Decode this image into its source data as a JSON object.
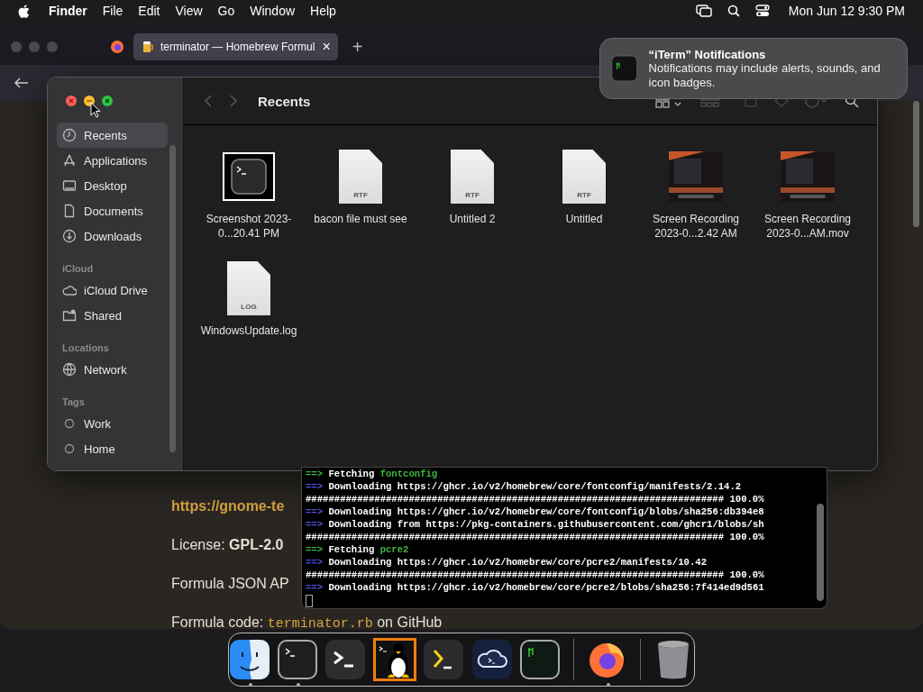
{
  "menu_bar": {
    "app": "Finder",
    "menus": [
      "File",
      "Edit",
      "View",
      "Go",
      "Window",
      "Help"
    ],
    "clock": "Mon Jun 12  9:30 PM"
  },
  "browser": {
    "tab": {
      "title": "terminator — Homebrew Formul",
      "close": "×",
      "selected": true
    },
    "new_tab": "+",
    "content": [
      {
        "kind": "link",
        "text": "https://gnome-te"
      },
      {
        "kind": "text",
        "text": "License: **GPL-2.0**"
      },
      {
        "kind": "text",
        "text": "Formula JSON AP"
      },
      {
        "kind": "code",
        "label": "Formula code:",
        "code": "terminator.rb",
        "suffix": "on GitHub"
      }
    ]
  },
  "notification": {
    "title": "“iTerm” Notifications",
    "body": "Notifications may include alerts, sounds, and icon badges."
  },
  "finder": {
    "title": "Recents",
    "sidebar": [
      {
        "items": [
          {
            "label": "Recents",
            "selected": true
          },
          {
            "label": "Applications",
            "selected": false
          },
          {
            "label": "Desktop",
            "selected": false
          },
          {
            "label": "Documents",
            "selected": false
          },
          {
            "label": "Downloads",
            "selected": false
          }
        ]
      },
      {
        "title": "iCloud",
        "items": [
          {
            "label": "iCloud Drive",
            "selected": false
          },
          {
            "label": "Shared",
            "selected": false
          }
        ]
      },
      {
        "title": "Locations",
        "items": [
          {
            "label": "Network",
            "selected": false
          }
        ]
      },
      {
        "title": "Tags",
        "items": [
          {
            "label": "Work",
            "selected": false
          },
          {
            "label": "Home",
            "selected": false
          }
        ]
      }
    ],
    "files": [
      {
        "name": "Screenshot 2023-0...20.41 PM",
        "kind": "screenshot"
      },
      {
        "name": "bacon file must see",
        "kind": "document",
        "badge": "RTF"
      },
      {
        "name": "Untitled 2",
        "kind": "document",
        "badge": "RTF"
      },
      {
        "name": "Untitled",
        "kind": "document",
        "badge": "RTF"
      },
      {
        "name": "Screen Recording 2023-0...2.42 AM",
        "kind": "video"
      },
      {
        "name": "Screen Recording 2023-0...AM.mov",
        "kind": "video"
      },
      {
        "name": "WindowsUpdate.log",
        "kind": "document",
        "badge": "LOG"
      }
    ]
  },
  "terminal": {
    "lines": [
      {
        "kind": "fetch",
        "arrow": "==>",
        "text": "Fetching",
        "name": "fontconfig"
      },
      {
        "kind": "info",
        "arrow": "==>",
        "text": "Downloading https://ghcr.io/v2/homebrew/core/fontconfig/manifests/2.14.2"
      },
      {
        "kind": "progress",
        "text": "######################################################################### 100.0%"
      },
      {
        "kind": "info",
        "arrow": "==>",
        "text": "Downloading https://ghcr.io/v2/homebrew/core/fontconfig/blobs/sha256:db394e8"
      },
      {
        "kind": "info",
        "arrow": "==>",
        "text": "Downloading from https://pkg-containers.githubusercontent.com/ghcr1/blobs/sh"
      },
      {
        "kind": "progress",
        "text": "######################################################################### 100.0%"
      },
      {
        "kind": "fetch",
        "arrow": "==>",
        "text": "Fetching",
        "name": "pcre2"
      },
      {
        "kind": "info",
        "arrow": "==>",
        "text": "Downloading https://ghcr.io/v2/homebrew/core/pcre2/manifests/10.42"
      },
      {
        "kind": "progress",
        "text": "######################################################################### 100.0%"
      },
      {
        "kind": "info",
        "arrow": "==>",
        "text": "Downloading https://ghcr.io/v2/homebrew/core/pcre2/blobs/sha256:7f414ed9d561"
      }
    ]
  },
  "dock": [
    {
      "kind": "finder",
      "running": true
    },
    {
      "kind": "terminal",
      "running": true
    },
    {
      "kind": "prompt",
      "running": false
    },
    {
      "kind": "penguin",
      "running": false
    },
    {
      "kind": "yellow-prompt",
      "running": false
    },
    {
      "kind": "cloud",
      "running": false
    },
    {
      "kind": "iterm",
      "running": false
    },
    {
      "kind": "separator"
    },
    {
      "kind": "firefox",
      "running": true
    },
    {
      "kind": "separator"
    },
    {
      "kind": "trash",
      "running": false
    }
  ]
}
